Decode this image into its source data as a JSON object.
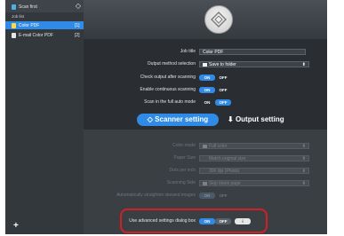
{
  "sidebar": {
    "header": "Scan first",
    "list_label": "Job list",
    "items": [
      {
        "name": "Color PDF",
        "num": "[1]"
      },
      {
        "name": "E-mail Color PDF",
        "num": "[2]"
      }
    ],
    "add_label": "+"
  },
  "form": {
    "job_title_label": "Job title",
    "job_title_value": "Color PDF",
    "output_method_label": "Output method selection",
    "output_method_value": "Save to folder",
    "check_output_label": "Check output after scanning",
    "continuous_label": "Enable continuous scanning",
    "auto_mode_label": "Scan in the full auto mode",
    "on": "ON",
    "off": "OFF"
  },
  "tabs": {
    "scanner": "Scanner setting",
    "output": "Output setting"
  },
  "scanner_settings": {
    "color_mode_label": "Color mode",
    "color_mode_value": "Full color",
    "paper_size_label": "Paper Size",
    "paper_size_value": "Match original size",
    "dots_per_inch_label": "Dots per inch",
    "dots_per_inch_value": "300 dpi (Photo)",
    "scanning_side_label": "Scanning Side",
    "scanning_side_value": "Skip blank page",
    "auto_straighten_label": "Automatically straighten skewed images",
    "advanced_label": "Use advanced settings dialog box"
  },
  "colors": {
    "accent": "#2f8be6",
    "highlight": "#d11f26",
    "sidebar_selected": "#2f8be6"
  }
}
